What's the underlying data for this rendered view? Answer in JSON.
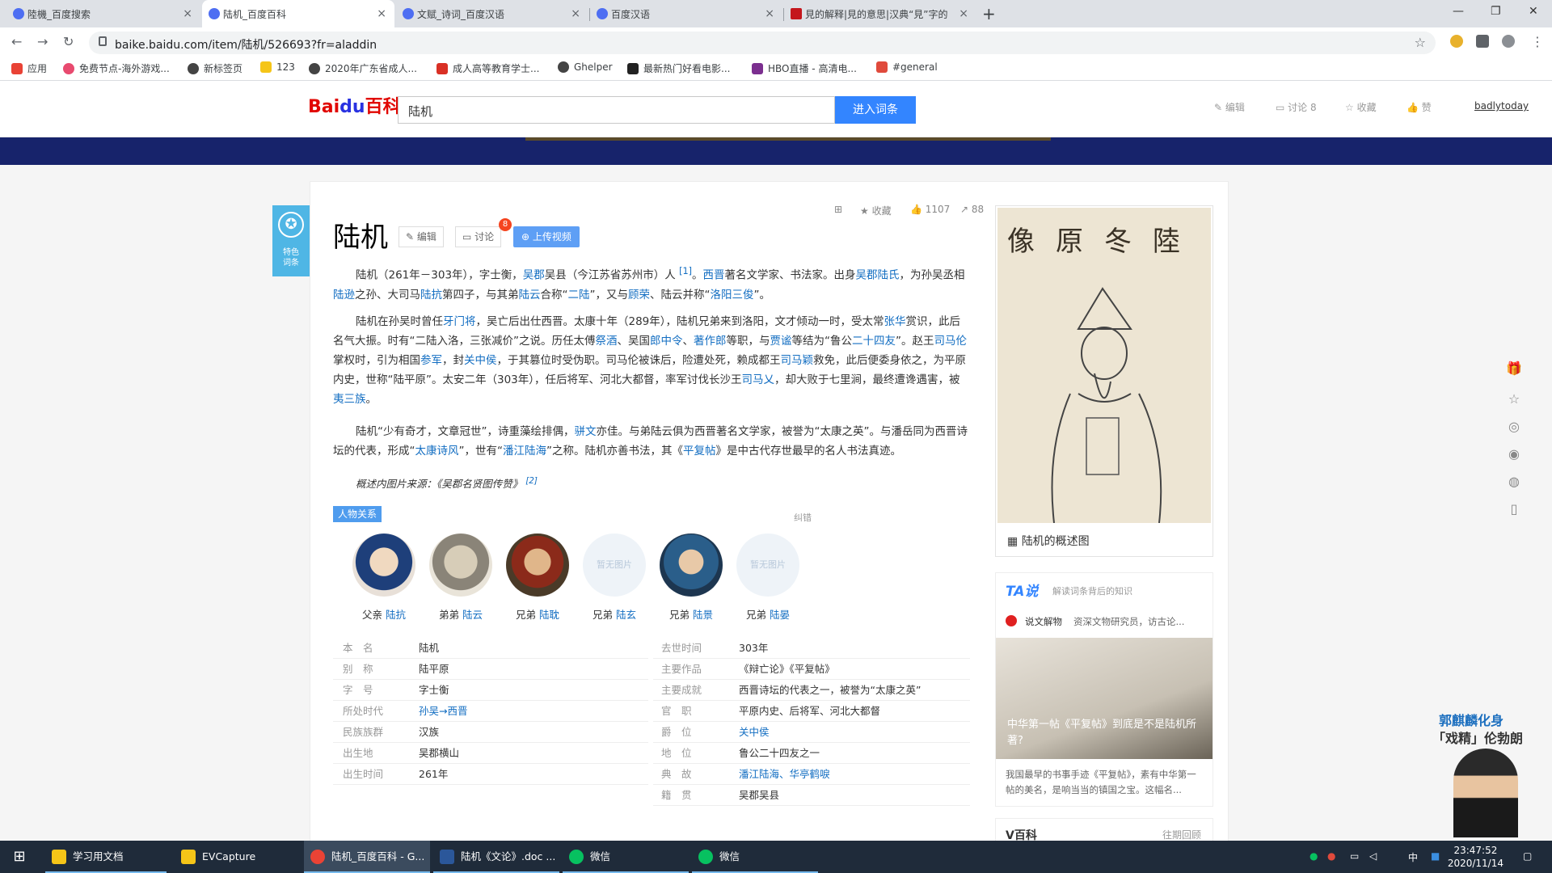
{
  "browser": {
    "tabs": [
      {
        "label": "陸機_百度搜索",
        "close": "×"
      },
      {
        "label": "陆机_百度百科",
        "close": "×"
      },
      {
        "label": "文赋_诗词_百度汉语",
        "close": "×"
      },
      {
        "label": "百度汉语",
        "close": "×"
      },
      {
        "label": "見的解释|見的意思|汉典“見”字的",
        "close": "×"
      }
    ],
    "new_tab": "+",
    "window_controls": {
      "minimize": "—",
      "maximize": "❐",
      "close": "✕"
    },
    "url": "baike.baidu.com/item/陆机/526693?fr=aladdin",
    "bookmarks": [
      "应用",
      "免费节点-海外游戏...",
      "新标签页",
      "123",
      "2020年广东省成人...",
      "成人高等教育学士...",
      "Ghelper",
      "最新热门好看电影...",
      "HBO直播 - 高清电...",
      "#general"
    ],
    "colors": {
      "tabstrip": "#dee1e6",
      "accent": "#4e6ef2"
    }
  },
  "baike_header": {
    "logo_text": "Bai",
    "logo_du": "du",
    "logo_suffix": "百科",
    "search_value": "陆机",
    "search_button": "进入词条",
    "actions": [
      "编辑",
      "讨论 8",
      "收藏",
      "赞"
    ],
    "username": "badlytoday"
  },
  "feature_tag": "特色词条",
  "entry": {
    "title": "陆机",
    "edit_btn": "编辑",
    "discuss_btn": "讨论",
    "discuss_badge": "8",
    "upload_btn": "上传视频",
    "stats": {
      "fav": "收藏",
      "likes": "1107",
      "shares": "88"
    },
    "para1_parts": [
      "陆机（261年－303年），字士衡，",
      "吴郡",
      "吴县（今江苏省苏州市）人 ",
      "[1]",
      "。",
      "西晋",
      "著名文学家、书法家。出身",
      "吴郡陆氏",
      "，为孙吴丞相",
      "陆逊",
      "之孙、大司马",
      "陆抗",
      "第四子，与其弟",
      "陆云",
      "合称“",
      "二陆",
      "”，又与",
      "顾荣",
      "、陆云并称“",
      "洛阳三俊",
      "”。"
    ],
    "para2_parts": [
      "陆机在孙吴时曾任",
      "牙门将",
      "，吴亡后出仕西晋。太康十年（289年），陆机兄弟来到洛阳，文才倾动一时，受太常",
      "张华",
      "赏识，此后名气大振。时有“二陆入洛，三张减价”之说。历任太傅",
      "祭酒",
      "、吴国",
      "郎中令",
      "、",
      "著作郎",
      "等职，与",
      "贾谧",
      "等结为“鲁公",
      "二十四友",
      "”。赵王",
      "司马伦",
      "掌权时，引为相国",
      "参军",
      "，封",
      "关中侯",
      "，于其篡位时受伪职。司马伦被诛后，险遭处死，赖成都王",
      "司马颖",
      "救免，此后便委身依之，为平原内史，世称“陆平原”。太安二年（303年），任后将军、河北大都督，率军讨伐长沙王",
      "司马乂",
      "，却大败于七里涧，最终遭谗遇害，被",
      "夷三族",
      "。"
    ],
    "para3_parts": [
      "陆机“少有奇才，文章冠世”，诗重藻绘排偶，",
      "骈文",
      "亦佳。与弟陆云俱为西晋著名文学家，被誉为“太康之英”。与潘岳同为西晋诗坛的代表，形成“",
      "太康诗风",
      "”，世有“",
      "潘江陆海",
      "”之称。陆机亦善书法，其《",
      "平复帖",
      "》是中古代存世最早的名人书法真迹。"
    ],
    "note": "概述内图片来源：《吴郡名贤图传赞》",
    "note_ref": "[2]"
  },
  "relations": {
    "tag": "人物关系",
    "correction": "纠错",
    "people": [
      {
        "rel": "父亲",
        "name": "陆抗"
      },
      {
        "rel": "弟弟",
        "name": "陆云"
      },
      {
        "rel": "兄弟",
        "name": "陆耽"
      },
      {
        "rel": "兄弟",
        "name": "陆玄"
      },
      {
        "rel": "兄弟",
        "name": "陆景"
      },
      {
        "rel": "兄弟",
        "name": "陆晏"
      }
    ],
    "placeholder": "暂无图片"
  },
  "infobox": {
    "left": [
      {
        "label": "本　名",
        "value": "陆机"
      },
      {
        "label": "别　称",
        "value": "陆平原"
      },
      {
        "label": "字　号",
        "value": "字士衡"
      },
      {
        "label": "所处时代",
        "value": "孙吴→西晋",
        "link": true
      },
      {
        "label": "民族族群",
        "value": "汉族"
      },
      {
        "label": "出生地",
        "value": "吴郡横山"
      },
      {
        "label": "出生时间",
        "value": "261年"
      }
    ],
    "right": [
      {
        "label": "去世时间",
        "value": "303年"
      },
      {
        "label": "主要作品",
        "value": "《辩亡论》《平复帖》"
      },
      {
        "label": "主要成就",
        "value": "西晋诗坛的代表之一，被誉为“太康之英”"
      },
      {
        "label": "官　职",
        "value": "平原内史、后将军、河北大都督"
      },
      {
        "label": "爵　位",
        "value": "关中侯",
        "link": true
      },
      {
        "label": "地　位",
        "value": "鲁公二十四友之一"
      },
      {
        "label": "典　故",
        "value": "潘江陆海、华亭鹤唳",
        "link": true
      },
      {
        "label": "籍　贯",
        "value": "吴郡吴县"
      }
    ]
  },
  "right_col": {
    "portrait_caption": "陆机的概述图",
    "portrait_text": "像原冬陸",
    "ta_title": "TA说",
    "ta_sub": "解读词条背后的知识",
    "ta_author": "说文解物",
    "ta_author_desc": "资深文物研究员，访古论...",
    "ta_card_title": "中华第一帖《平复帖》到底是不是陆机所著?",
    "ta_desc": "我国最早的书事手迹《平复帖》，素有中华第一帖的美名，是响当当的镇国之宝。这幅名...",
    "vbaike": "V百科",
    "vbaike_more": "往期回顾"
  },
  "ad": {
    "line1": "郭麒麟化身",
    "line2": "「戏精」伦勃朗"
  },
  "taskbar": {
    "items": [
      "学习用文档",
      "EVCapture",
      "陆机_百度百科 - G...",
      "陆机《文论》.doc ...",
      "微信",
      "微信"
    ],
    "time": "23:47:52",
    "date": "2020/11/14",
    "ime": "中"
  }
}
